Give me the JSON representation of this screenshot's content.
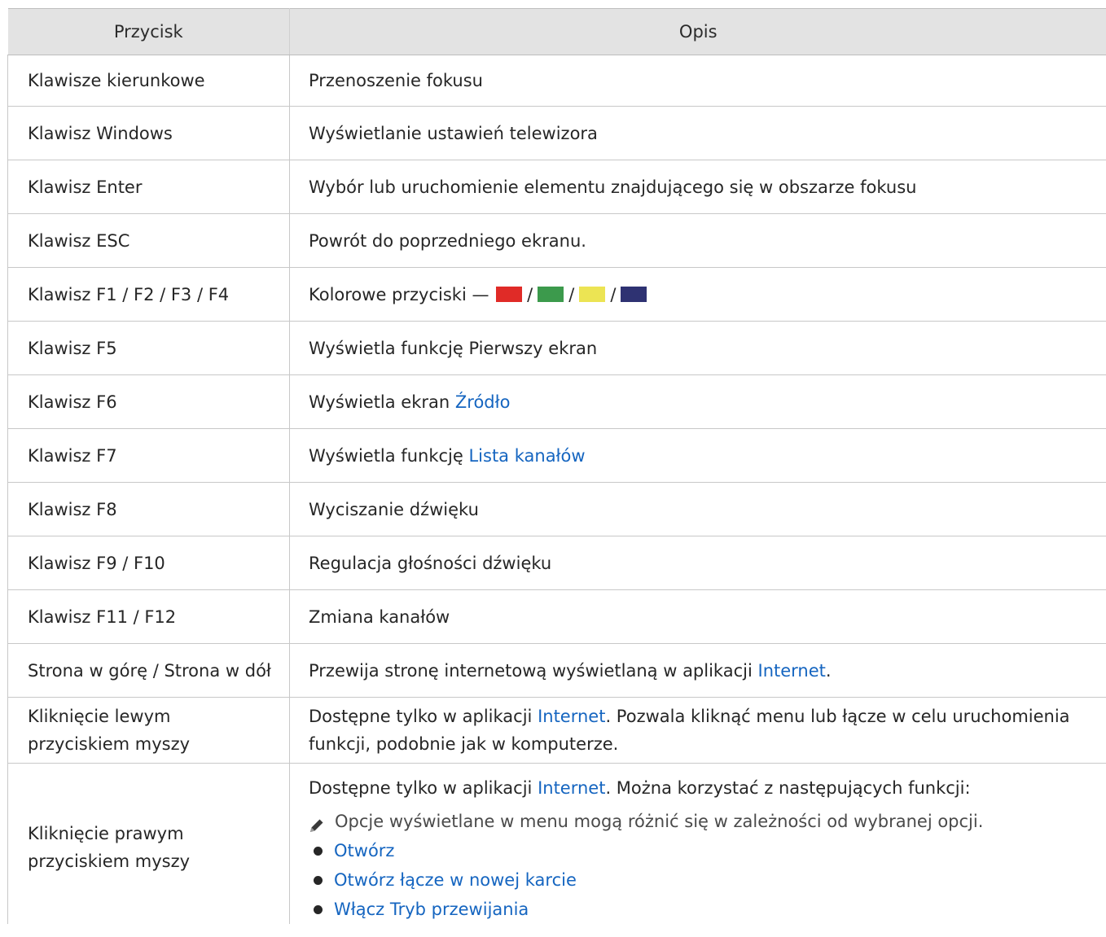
{
  "header": {
    "col1": "Przycisk",
    "col2": "Opis"
  },
  "rows": [
    {
      "key": "Klawisze kierunkowe",
      "desc": "Przenoszenie fokusu"
    },
    {
      "key": "Klawisz Windows",
      "desc": "Wyświetlanie ustawień telewizora"
    },
    {
      "key": "Klawisz Enter",
      "desc": "Wybór lub uruchomienie elementu znajdującego się w obszarze fokusu"
    },
    {
      "key": "Klawisz ESC",
      "desc": "Powrót do poprzedniego ekranu."
    },
    {
      "key": "Klawisz F1 / F2 / F3 / F4",
      "desc_prefix": "Kolorowe przyciski —",
      "separator": "/",
      "swatch_colors": [
        "#e02b27",
        "#3c9a4c",
        "#ece453",
        "#2e3272"
      ]
    },
    {
      "key": "Klawisz F5",
      "desc": "Wyświetla funkcję Pierwszy ekran"
    },
    {
      "key": "Klawisz F6",
      "desc_prefix": "Wyświetla ekran",
      "link": "Źródło"
    },
    {
      "key": "Klawisz F7",
      "desc_prefix": "Wyświetla funkcję",
      "link": "Lista kanałów"
    },
    {
      "key": "Klawisz F8",
      "desc": "Wyciszanie dźwięku"
    },
    {
      "key": "Klawisz F9 / F10",
      "desc": "Regulacja głośności dźwięku"
    },
    {
      "key": "Klawisz F11 / F12",
      "desc": "Zmiana kanałów"
    },
    {
      "key": "Strona w górę / Strona w dół",
      "desc_prefix": "Przewija stronę internetową wyświetlaną w aplikacji",
      "link": "Internet",
      "desc_suffix": "."
    },
    {
      "key": "Kliknięcie lewym przyciskiem myszy",
      "desc_prefix": "Dostępne tylko w aplikacji",
      "link": "Internet",
      "desc_suffix": ". Pozwala kliknąć menu lub łącze w celu uruchomienia funkcji, podobnie jak w komputerze."
    },
    {
      "key": "Kliknięcie prawym przyciskiem myszy",
      "desc_prefix": "Dostępne tylko w aplikacji",
      "link": "Internet",
      "desc_suffix": ". Można korzystać z następujących funkcji:",
      "note_icon": "pencil-icon",
      "note": "Opcje wyświetlane w menu mogą różnić się w zależności od wybranej opcji.",
      "options": [
        "Otwórz",
        "Otwórz łącze w nowej karcie",
        "Włącz Tryb przewijania"
      ]
    }
  ],
  "colors": {
    "link": "#1565c0",
    "header_bg": "#e3e3e3"
  }
}
